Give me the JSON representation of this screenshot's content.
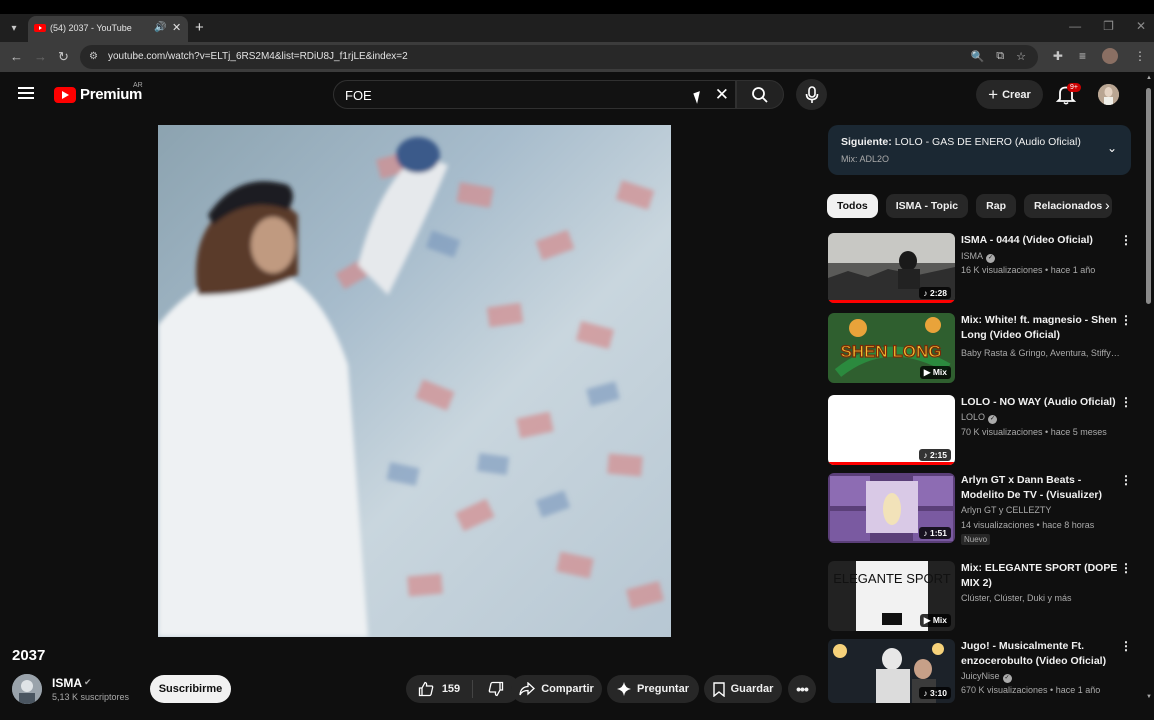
{
  "browser": {
    "tab_title": "(54) 2037 - YouTube",
    "url": "youtube.com/watch?v=ELTj_6RS2M4&list=RDiU8J_f1rjLE&index=2"
  },
  "header": {
    "logo_text": "Premium",
    "region": "AR",
    "search_value": "FOE",
    "create_label": "Crear",
    "notif_count": "9+"
  },
  "video": {
    "title": "2037",
    "channel": "ISMA",
    "subscribers": "5,13 K suscriptores",
    "subscribe_label": "Suscribirme",
    "likes": "159",
    "share_label": "Compartir",
    "ask_label": "Preguntar",
    "save_label": "Guardar"
  },
  "up_next": {
    "prefix": "Siguiente:",
    "title": "LOLO - GAS DE ENERO (Audio Oficial)",
    "mix": "Mix: ADL2O"
  },
  "chips": [
    "Todos",
    "ISMA - Topic",
    "Rap",
    "Relacionados"
  ],
  "recommendations": [
    {
      "title": "ISMA - 0444 (Video Oficial)",
      "channel": "ISMA",
      "verified": true,
      "meta": "16 K visualizaciones • hace 1 año",
      "duration": "2:28",
      "badge": "",
      "thumb": "#4a4a48"
    },
    {
      "title": "Mix: White! ft. magnesio - Shen Long (Video Oficial)",
      "channel": "Baby Rasta & Gringo, Aventura, Stiffy y m...",
      "verified": false,
      "meta": "",
      "duration": "Mix",
      "badge": "",
      "thumb": "#3f6b3a"
    },
    {
      "title": "LOLO - NO WAY (Audio Oficial)",
      "channel": "LOLO",
      "verified": true,
      "meta": "70 K visualizaciones • hace 5 meses",
      "duration": "2:15",
      "badge": "",
      "thumb": "#ffffff"
    },
    {
      "title": "Arlyn GT x Dann Beats - Modelito De TV - (Visualizer)",
      "channel": "Arlyn GT y CELLEZTY",
      "verified": false,
      "meta": "14 visualizaciones • hace 8 horas",
      "duration": "1:51",
      "badge": "Nuevo",
      "thumb": "#6a4e86"
    },
    {
      "title": "Mix: ELEGANTE SPORT (DOPE MIX 2)",
      "channel": "Clúster, Clúster, Duki y más",
      "verified": false,
      "meta": "",
      "duration": "Mix",
      "badge": "",
      "thumb": "#1c1c1c"
    },
    {
      "title": "Jugo! - Musicalmente Ft. enzocerobulto (Video Oficial)",
      "channel": "JuicyNise",
      "verified": true,
      "meta": "670 K visualizaciones • hace 1 año",
      "duration": "3:10",
      "badge": "",
      "thumb": "#2a3038"
    }
  ],
  "thumb_texts": {
    "shen_long": "SHEN LONG",
    "elegante": "ELEGANTE SPORT"
  }
}
